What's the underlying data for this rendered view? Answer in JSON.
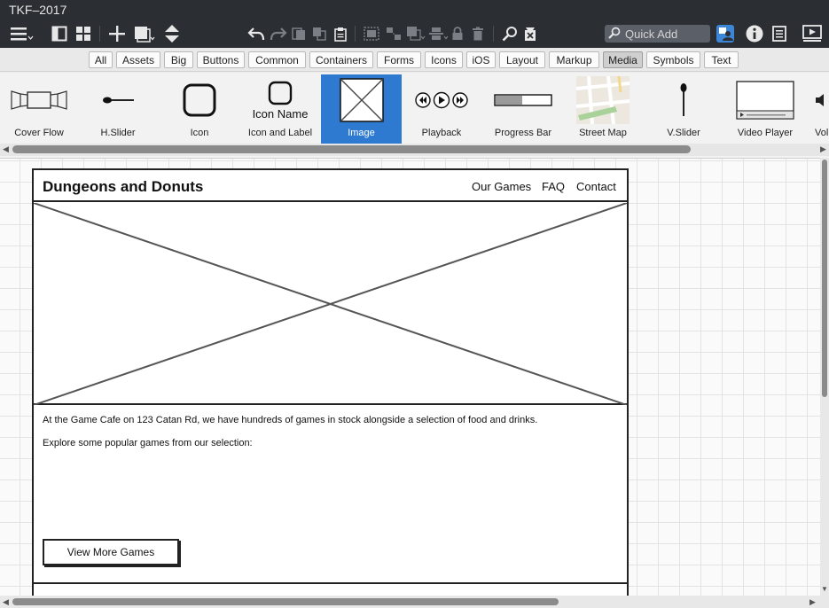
{
  "app": {
    "title": "TKF–2017"
  },
  "toolbar": {
    "left_icons": [
      "menu-icon",
      "panel-icon",
      "grid-icon",
      "add-icon",
      "duplicate-icon",
      "reorder-icon"
    ],
    "middle_icons": [
      "undo-icon",
      "redo-icon",
      "copy-icon",
      "paste-style-icon",
      "clipboard-icon",
      "group-icon",
      "ungroup-icon",
      "arrange-icon",
      "align-icon",
      "lock-icon",
      "trash-icon",
      "search-icon",
      "clear-icon"
    ],
    "right_icons": [
      "user-icon",
      "info-icon",
      "notes-icon",
      "present-icon"
    ],
    "quick_add_placeholder": "Quick Add"
  },
  "filter_tabs": [
    {
      "label": "All",
      "active": false
    },
    {
      "label": "Assets",
      "active": false
    },
    {
      "label": "Big",
      "active": false
    },
    {
      "label": "Buttons",
      "active": false
    },
    {
      "label": "Common",
      "active": false
    },
    {
      "label": "Containers",
      "active": false
    },
    {
      "label": "Forms",
      "active": false
    },
    {
      "label": "Icons",
      "active": false
    },
    {
      "label": "iOS",
      "active": false
    },
    {
      "label": "Layout",
      "active": false
    },
    {
      "label": "Markup",
      "active": false
    },
    {
      "label": "Media",
      "active": true
    },
    {
      "label": "Symbols",
      "active": false
    },
    {
      "label": "Text",
      "active": false
    }
  ],
  "library_items": [
    {
      "label": "Cover Flow",
      "icon": "cover-flow-icon"
    },
    {
      "label": "H.Slider",
      "icon": "hslider-icon"
    },
    {
      "label": "Icon",
      "icon": "icon-placeholder-icon"
    },
    {
      "label": "Icon and Label",
      "icon": "icon-label-icon",
      "thumb_text": "Icon Name"
    },
    {
      "label": "Image",
      "icon": "image-placeholder-icon",
      "selected": true
    },
    {
      "label": "Playback",
      "icon": "playback-icon"
    },
    {
      "label": "Progress Bar",
      "icon": "progress-bar-icon"
    },
    {
      "label": "Street Map",
      "icon": "street-map-icon"
    },
    {
      "label": "V.Slider",
      "icon": "vslider-icon"
    },
    {
      "label": "Video Player",
      "icon": "video-player-icon"
    },
    {
      "label": "Vol",
      "icon": "volume-icon"
    }
  ],
  "wireframe": {
    "site_title": "Dungeons and Donuts",
    "nav": [
      "Our Games",
      "FAQ",
      "Contact"
    ],
    "paragraph_1": "At the Game Cafe on 123 Catan Rd, we have hundreds of games in stock alongside a selection of food and drinks.",
    "paragraph_2": "Explore some popular games from our selection:",
    "cta_label": "View More Games"
  },
  "colors": {
    "titlebar": "#2b2e33",
    "selection": "#2f7ad1",
    "canvas": "#fafafa",
    "grid": "#e3e3e3"
  }
}
